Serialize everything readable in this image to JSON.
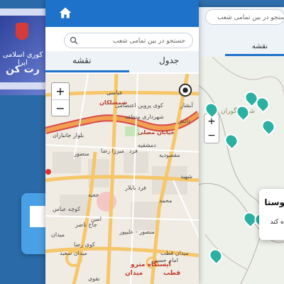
{
  "background_app": {
    "banner_line1": "کوری اسلامی ایرا",
    "banner_line2": "رت کن",
    "colors": {
      "accent": "#1f72c9",
      "banner": "#2b3f9a"
    }
  },
  "center_screen": {
    "search_placeholder": "جستجو در بین تمامی شعب",
    "tabs": {
      "map": "نقشه",
      "table": "جدول"
    },
    "zoom": {
      "in": "+",
      "out": "−"
    },
    "labels": [
      {
        "text": "عباسی",
        "cls": "road"
      },
      {
        "text": "شمشلکان",
        "cls": "red"
      },
      {
        "text": "کوی پروین اعتصامی",
        "cls": ""
      },
      {
        "text": "شهرداری منطقه",
        "cls": ""
      },
      {
        "text": "آبشار",
        "cls": ""
      },
      {
        "text": "دانش",
        "cls": ""
      },
      {
        "text": "بلوار جانبازان",
        "cls": "road"
      },
      {
        "text": "خیابان مصلی",
        "cls": "red"
      },
      {
        "text": "منصور",
        "cls": ""
      },
      {
        "text": "میرزا رضا",
        "cls": ""
      },
      {
        "text": "فرد",
        "cls": ""
      },
      {
        "text": "مقصودیه",
        "cls": ""
      },
      {
        "text": "دمشقیه",
        "cls": ""
      },
      {
        "text": "شهید",
        "cls": ""
      },
      {
        "text": "فرد بابلار",
        "cls": ""
      },
      {
        "text": "محمد",
        "cls": ""
      },
      {
        "text": "جعبه",
        "cls": ""
      },
      {
        "text": "کوچه عباس",
        "cls": ""
      },
      {
        "text": "امین",
        "cls": ""
      },
      {
        "text": "جاج ناصر",
        "cls": ""
      },
      {
        "text": "میدان",
        "cls": ""
      },
      {
        "text": "منصور - علیپور",
        "cls": ""
      },
      {
        "text": "کوی رضا",
        "cls": ""
      },
      {
        "text": "میدان سعید",
        "cls": ""
      },
      {
        "text": "میدان قطب",
        "cls": ""
      },
      {
        "text": "امام حسین",
        "cls": ""
      },
      {
        "text": "ایستگاه مترو",
        "cls": "metro"
      },
      {
        "text": "میدان",
        "cls": "metro"
      },
      {
        "text": "قطب",
        "cls": "metro"
      },
      {
        "text": "نقوی",
        "cls": ""
      }
    ]
  },
  "right_screen": {
    "search_placeholder": "جستجو در بین تمامی شعب",
    "tab_map": "نقشه",
    "place_label": "شده انگوران",
    "zoom": {
      "in": "+",
      "out": "−"
    },
    "popup_title": "وستا",
    "popup_sub": "ه کند-"
  }
}
